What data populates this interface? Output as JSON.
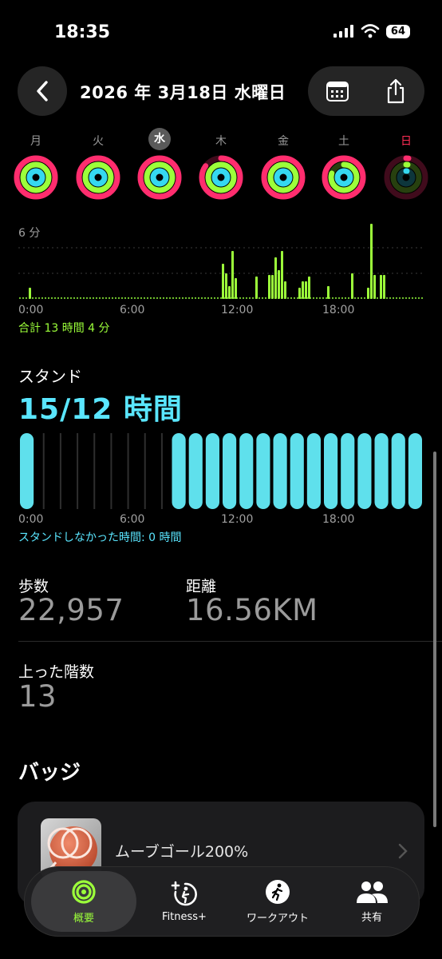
{
  "status_bar": {
    "time": "18:35",
    "battery": "64"
  },
  "header": {
    "title": "2026 年 3月18日 水曜日"
  },
  "week": {
    "days": [
      {
        "label": "月",
        "move": 1.0,
        "exercise": 1.0,
        "stand": 1.0
      },
      {
        "label": "火",
        "move": 1.0,
        "exercise": 1.0,
        "stand": 1.0
      },
      {
        "label": "水",
        "move": 1.0,
        "exercise": 1.0,
        "stand": 1.0
      },
      {
        "label": "木",
        "move": 0.85,
        "exercise": 1.0,
        "stand": 1.0
      },
      {
        "label": "金",
        "move": 1.0,
        "exercise": 1.0,
        "stand": 1.0
      },
      {
        "label": "土",
        "move": 1.0,
        "exercise": 0.8,
        "stand": 1.0
      },
      {
        "label": "日",
        "move": 0.02,
        "exercise": 0.02,
        "stand": 0.02
      }
    ],
    "today_index": 2,
    "colors": {
      "move": "#ff2d6e",
      "exercise": "#9cff3a",
      "stand": "#35d8f0"
    }
  },
  "exercise_chart": {
    "y_label": "6 分",
    "x_ticks": [
      "0:00",
      "6:00",
      "12:00",
      "18:00"
    ],
    "total": "合計 13 時間 4 分"
  },
  "stand": {
    "title": "スタンド",
    "value": "15/12 時間",
    "x_ticks": [
      "0:00",
      "6:00",
      "12:00",
      "18:00"
    ],
    "note": "スタンドしなかった時間: 0 時間",
    "hours_stood": [
      1,
      0,
      0,
      0,
      0,
      0,
      0,
      0,
      0,
      1,
      1,
      1,
      1,
      1,
      1,
      1,
      1,
      1,
      1,
      1,
      1,
      1,
      1,
      1
    ]
  },
  "metrics": {
    "steps_label": "歩数",
    "steps_value": "22,957",
    "distance_label": "距離",
    "distance_value": "16.56KM",
    "flights_label": "上った階数",
    "flights_value": "13"
  },
  "badges": {
    "title": "バッジ",
    "item_label": "ムーブゴール200%"
  },
  "tabs": [
    {
      "label": "概要"
    },
    {
      "label": "Fitness+"
    },
    {
      "label": "ワークアウト"
    },
    {
      "label": "共有"
    }
  ]
}
